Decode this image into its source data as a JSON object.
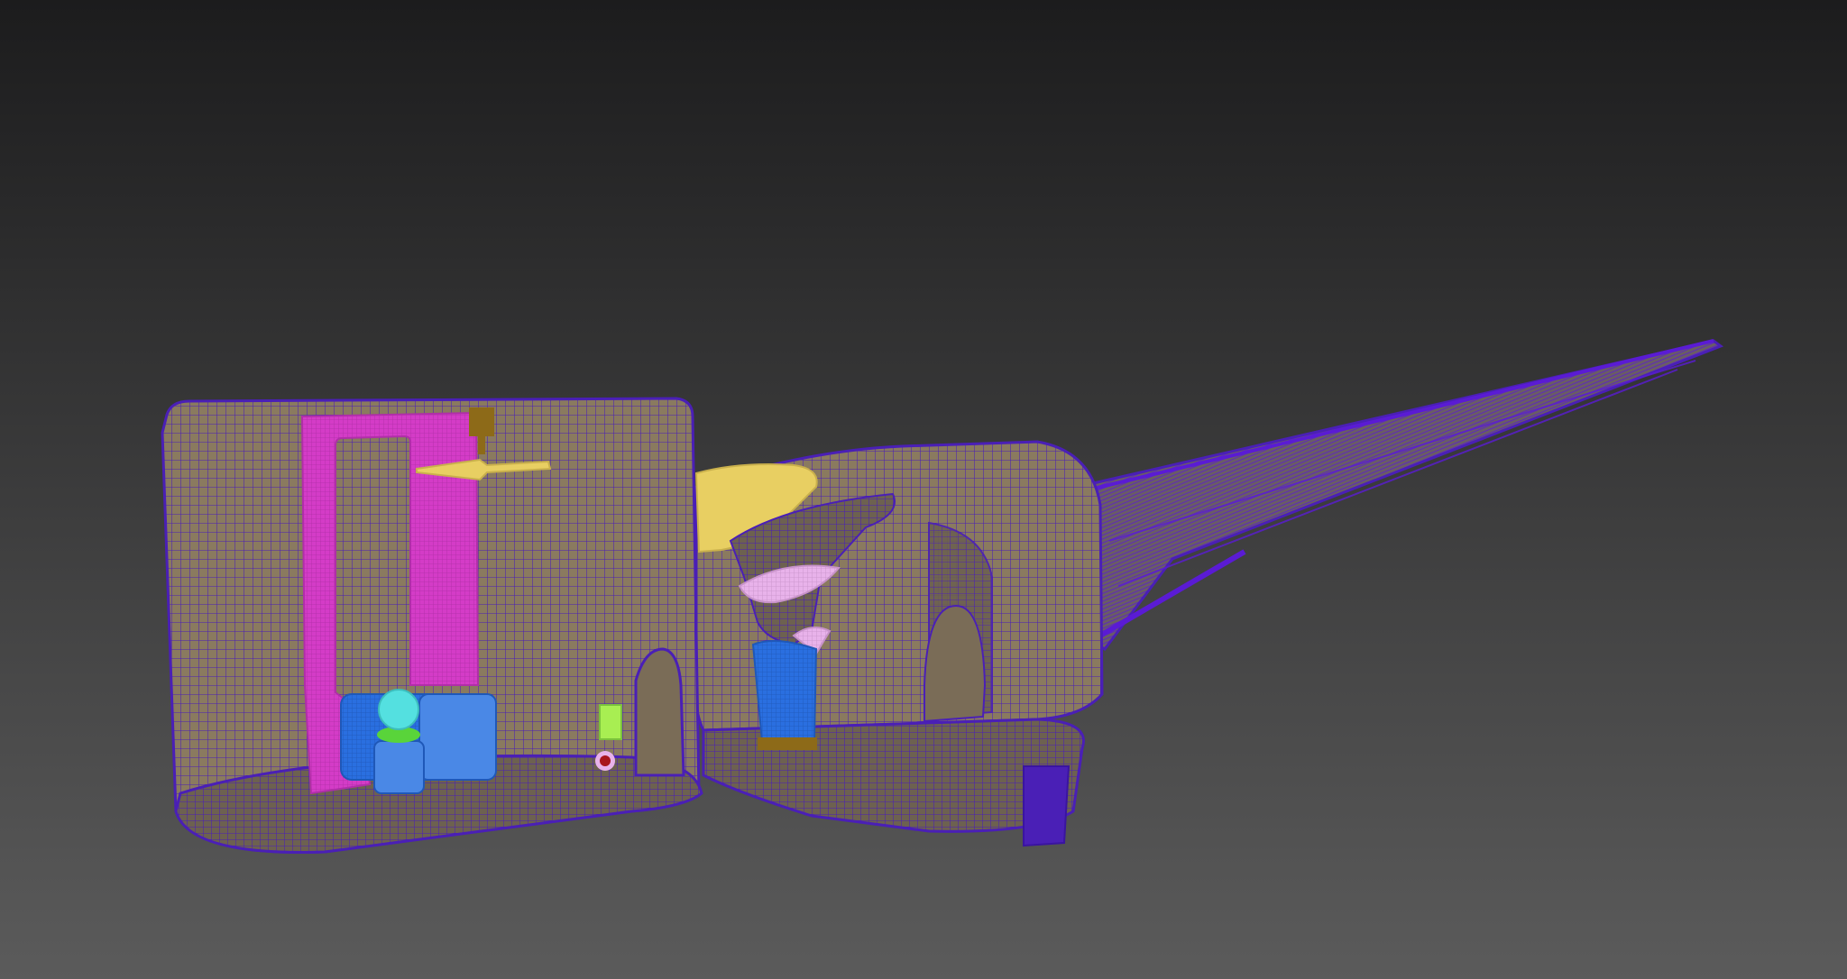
{
  "viewport": {
    "background_top": "#1c1c1d",
    "background_bottom": "#5b5b5b"
  },
  "colors": {
    "mesh_fill": "#8a7a5f",
    "mesh_fill_dark": "#6d6150",
    "wire": "#4a1fb6",
    "wire_bright": "#5a1bd4",
    "pink_frame": "#d43cc7",
    "yellow": "#e8cf62",
    "olive": "#8d6a18",
    "blue": "#2a6fe0",
    "blue_light": "#4a88e6",
    "cyan": "#54e0e0",
    "green": "#59d43a",
    "lime": "#a8ee52",
    "pink_light": "#e8b2ea",
    "red": "#a8151d"
  },
  "objects": {
    "room_left": "room-left-mesh",
    "room_right": "room-right-mesh",
    "spike": "spike-mesh",
    "door_frame": "door-frame",
    "ceiling_fan": "ceiling-fan",
    "funnel": "funnel-mesh",
    "vase": "vase-mesh",
    "sofa": "sofa-mesh"
  }
}
